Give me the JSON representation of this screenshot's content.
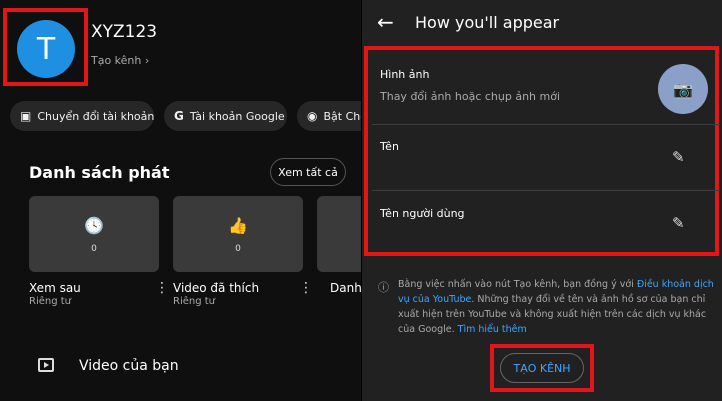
{
  "channel": {
    "initial": "T",
    "name": "XYZ123",
    "create_link": "Tạo kênh",
    "avatar_color": "#1e8fe1"
  },
  "chips": [
    {
      "label": "Chuyển đổi tài khoản",
      "icon": "switch-account-icon"
    },
    {
      "label": "Tài khoản Google",
      "icon": "google-icon"
    },
    {
      "label": "Bật Chế",
      "icon": "incognito-icon"
    }
  ],
  "playlists": {
    "title": "Danh sách phát",
    "see_all": "Xem tất cả",
    "items": [
      {
        "title": "Xem sau",
        "privacy": "Riêng tư",
        "count": "0",
        "icon": "clock-icon"
      },
      {
        "title": "Video đã thích",
        "privacy": "Riêng tư",
        "count": "0",
        "icon": "thumbs-up-icon"
      },
      {
        "title": "Danh",
        "privacy": "",
        "count": "",
        "icon": ""
      }
    ]
  },
  "your_videos": "Video của bạn",
  "appear": {
    "title": "How you'll appear",
    "photo_label": "Hình ảnh",
    "photo_sub": "Thay đổi ảnh hoặc chụp ảnh mới",
    "name_label": "Tên",
    "handle_label": "Tên người dùng",
    "info_1": "Bằng việc nhấn vào nút Tạo kênh, bạn đồng ý với ",
    "info_link_1": "Điều khoản dịch vụ của YouTube",
    "info_2": ". Những thay đổi về tên và ảnh hồ sơ của bạn chỉ xuất hiện trên YouTube và không xuất hiện trên các dịch vụ khác của Google. ",
    "info_link_2": "Tìm hiểu thêm",
    "create_button": "TẠO KÊNH",
    "accent": "#3ea6ff",
    "highlight": "#e0161b"
  }
}
